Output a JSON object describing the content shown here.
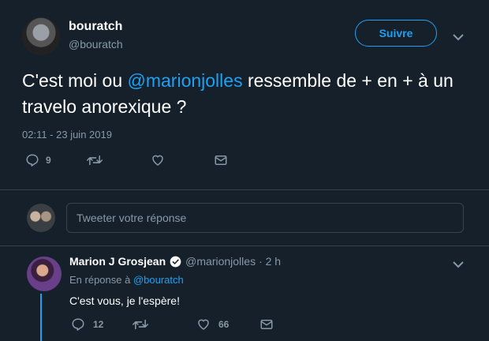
{
  "tweet": {
    "author_name": "bouratch",
    "author_handle": "@bouratch",
    "follow_label": "Suivre",
    "text_part1": "C'est moi ou ",
    "mention": "@marionjolles",
    "text_part2": " ressemble de + en + à un travelo anorexique ?",
    "timestamp": "02:11 - 23 juin 2019",
    "reply_count": "9",
    "retweet_count": "",
    "like_count": ""
  },
  "composer": {
    "placeholder": "Tweeter votre réponse"
  },
  "reply": {
    "author_name": "Marion J Grosjean",
    "author_handle": "@marionjolles",
    "time": "· 2 h",
    "in_reply_prefix": "En réponse à",
    "in_reply_handle": "@bouratch",
    "text": "C'est vous, je l'espère!",
    "reply_count": "12",
    "retweet_count": "",
    "like_count": "66"
  },
  "colors": {
    "background": "#15202b",
    "accent": "#1da1f2",
    "muted": "#8899a6",
    "border": "#38444d"
  },
  "icons": [
    "chevron-down-icon",
    "reply-icon",
    "retweet-icon",
    "like-icon",
    "message-icon",
    "verified-badge-icon"
  ]
}
